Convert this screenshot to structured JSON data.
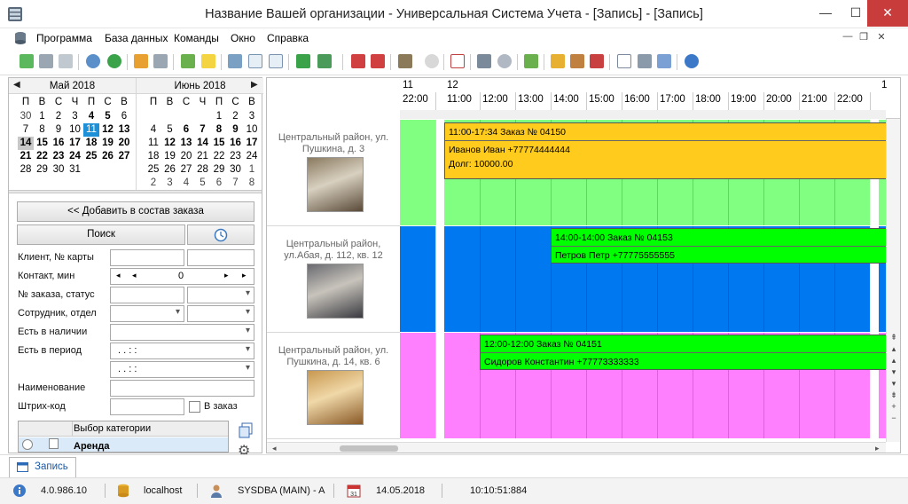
{
  "window": {
    "title": "Название Вашей организации - Универсальная Система Учета - [Запись] - [Запись]",
    "minimize": "—",
    "maximize": "☐",
    "close": "✕"
  },
  "menu": {
    "items": [
      "Программа",
      "База данных",
      "Команды",
      "Окно",
      "Справка"
    ],
    "mdi_controls": [
      "—",
      "❐",
      "✕"
    ]
  },
  "calendar": {
    "left": {
      "month": "Май 2018",
      "weekdays": [
        "П",
        "В",
        "С",
        "Ч",
        "П",
        "С",
        "В"
      ],
      "weeks": [
        [
          "30",
          "1",
          "2",
          "3",
          "4",
          "5",
          "6"
        ],
        [
          "7",
          "8",
          "9",
          "10",
          "11",
          "12",
          "13"
        ],
        [
          "14",
          "15",
          "16",
          "17",
          "18",
          "19",
          "20"
        ],
        [
          "21",
          "22",
          "23",
          "24",
          "25",
          "26",
          "27"
        ],
        [
          "28",
          "29",
          "30",
          "31",
          "",
          "",
          ""
        ]
      ]
    },
    "right": {
      "month": "Июнь 2018",
      "weekdays": [
        "П",
        "В",
        "С",
        "Ч",
        "П",
        "С",
        "В"
      ],
      "weeks": [
        [
          "",
          "",
          "",
          "",
          "1",
          "2",
          "3"
        ],
        [
          "4",
          "5",
          "6",
          "7",
          "8",
          "9",
          "10"
        ],
        [
          "11",
          "12",
          "13",
          "14",
          "15",
          "16",
          "17"
        ],
        [
          "18",
          "19",
          "20",
          "21",
          "22",
          "23",
          "24"
        ],
        [
          "25",
          "26",
          "27",
          "28",
          "29",
          "30",
          "1"
        ],
        [
          "2",
          "3",
          "4",
          "5",
          "6",
          "7",
          "8"
        ]
      ]
    },
    "prev_arrow": "◀",
    "next_arrow": "▶"
  },
  "form": {
    "add_to_order": "<< Добавить в состав заказа",
    "search": "Поиск",
    "client_label": "Клиент, № карты",
    "contact_label": "Контакт, мин",
    "contact_value": "0",
    "order_label": "№ заказа, статус",
    "employee_label": "Сотрудник, отдел",
    "available_label": "Есть в наличии",
    "period_label": "Есть в период",
    "period_from": ". .   : :",
    "period_to": ". .   : :",
    "name_label": "Наименование",
    "barcode_label": "Штрих-код",
    "in_order_label": "В заказ",
    "category_header": "Выбор категории",
    "category_first": "Аренда"
  },
  "schedule": {
    "day_labels": [
      "11",
      "12",
      "1"
    ],
    "hours": [
      "22:00",
      "11:00",
      "12:00",
      "13:00",
      "14:00",
      "15:00",
      "16:00",
      "17:00",
      "18:00",
      "19:00",
      "20:00",
      "21:00",
      "22:00"
    ],
    "properties": [
      {
        "address": "Центральный район, ул. Пушкина, д. 3",
        "photo": "bedroom-photo-1"
      },
      {
        "address": "Центральный район, ул.Абая, д. 112, кв. 12",
        "photo": "bedroom-photo-2"
      },
      {
        "address": "Центральный район, ул. Пушкина, д. 14, кв. 6",
        "photo": "living-room-photo"
      }
    ],
    "lane_colors": [
      "#80ff80",
      "#0078f0",
      "#ff80ff"
    ],
    "events": [
      {
        "line1": "11:00-17:34 Заказ № 04150",
        "line2": "Иванов Иван +77774444444",
        "line3": "Долг: 10000.00",
        "color": "#ffcc1e"
      },
      {
        "line1": "14:00-14:00 Заказ № 04153",
        "line2": "Петров Петр +77775555555",
        "line3": "",
        "color": "#00ff00"
      },
      {
        "line1": "12:00-12:00 Заказ № 04151",
        "line2": "Сидоров Константин +77773333333",
        "line3": "",
        "color": "#00ff00"
      }
    ]
  },
  "tab": {
    "label": "Запись"
  },
  "status": {
    "version": "4.0.986.10",
    "host": "localhost",
    "user": "SYSDBA (MAIN) - A",
    "date": "14.05.2018",
    "time": "10:10:51:884"
  }
}
